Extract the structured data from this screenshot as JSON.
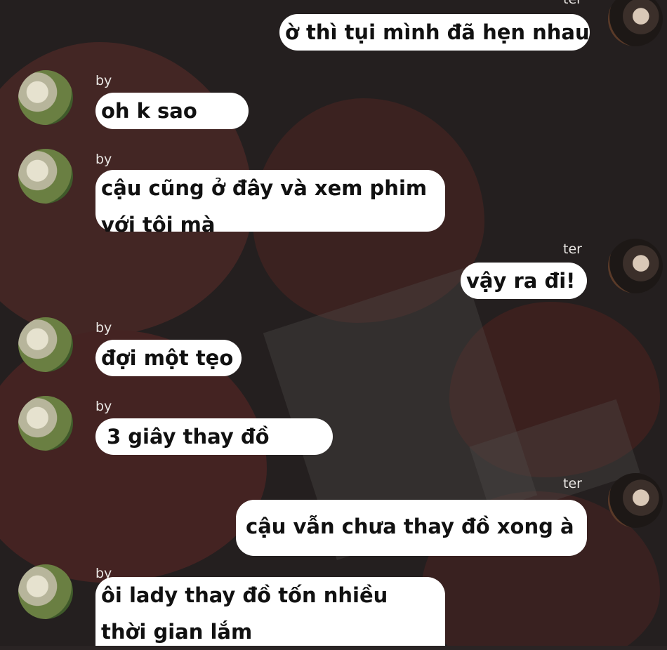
{
  "participants": {
    "left_name": "by",
    "right_name": "ter"
  },
  "messages": [
    {
      "sender": "ter",
      "side": "right",
      "text": "ờ thì tụi mình đã hẹn nhau"
    },
    {
      "sender": "by",
      "side": "left",
      "text": "oh k sao"
    },
    {
      "sender": "by",
      "side": "left",
      "text": "cậu cũng ở đây và xem phim với tôi mà"
    },
    {
      "sender": "ter",
      "side": "right",
      "text": "vậy ra đi!"
    },
    {
      "sender": "by",
      "side": "left",
      "text": "đợi một tẹo"
    },
    {
      "sender": "by",
      "side": "left",
      "text": "3 giây thay đồ"
    },
    {
      "sender": "ter",
      "side": "right",
      "text": "cậu vẫn chưa thay đồ xong à"
    },
    {
      "sender": "by",
      "side": "left",
      "text": "ôi lady thay đồ tốn nhiều thời gian lắm"
    }
  ]
}
